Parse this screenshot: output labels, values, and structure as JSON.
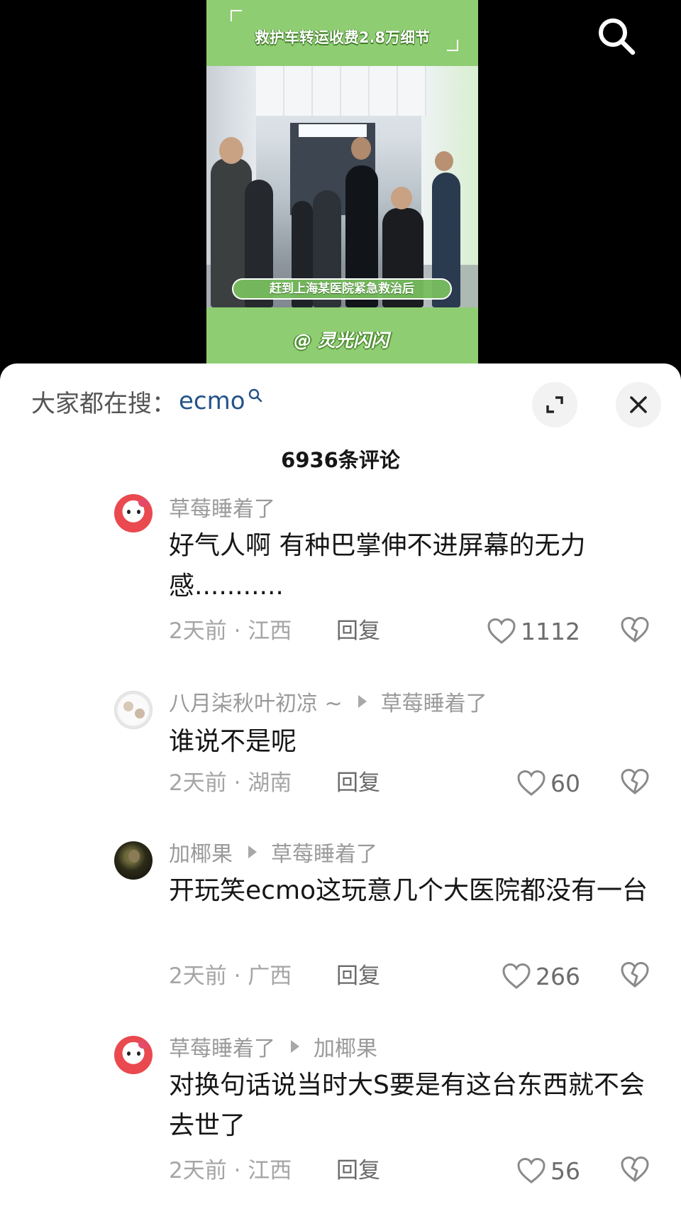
{
  "video": {
    "title": "救护车转运收费2.8万细节",
    "caption": "赶到上海某医院紧急救治后",
    "watermark": "@ 灵光闪闪"
  },
  "panel": {
    "hot_search_label": "大家都在搜：",
    "hot_search_term": "ecmo",
    "comment_count": "6936条评论"
  },
  "comments": [
    {
      "author": "草莓睡着了",
      "reply_to": "",
      "text": "好气人啊 有种巴掌伸不进屏幕的无力感...........",
      "time_location": "2天前 · 江西",
      "reply_label": "回复",
      "likes": "1112"
    },
    {
      "author": "八月柒秋叶初凉 ~",
      "reply_to": "草莓睡着了",
      "text": "谁说不是呢",
      "time_location": "2天前 · 湖南",
      "reply_label": "回复",
      "likes": "60"
    },
    {
      "author": "加椰果",
      "reply_to": "草莓睡着了",
      "text": "开玩笑ecmo这玩意几个大医院都没有一台",
      "time_location": "2天前 · 广西",
      "reply_label": "回复",
      "likes": "266"
    },
    {
      "author": "草莓睡着了",
      "reply_to": "加椰果",
      "text": "对换句话说当时大S要是有这台东西就不会去世了",
      "time_location": "2天前 · 江西",
      "reply_label": "回复",
      "likes": "56"
    }
  ],
  "colors": {
    "thumb_green": "#8fcd73",
    "hot_search_blue": "#245389",
    "meta_gray": "#9a9a9a"
  },
  "icons": [
    "search-icon",
    "search-small-icon",
    "expand-icon",
    "close-icon",
    "heart-icon",
    "dislike-heart-icon",
    "reply-arrow-icon"
  ]
}
